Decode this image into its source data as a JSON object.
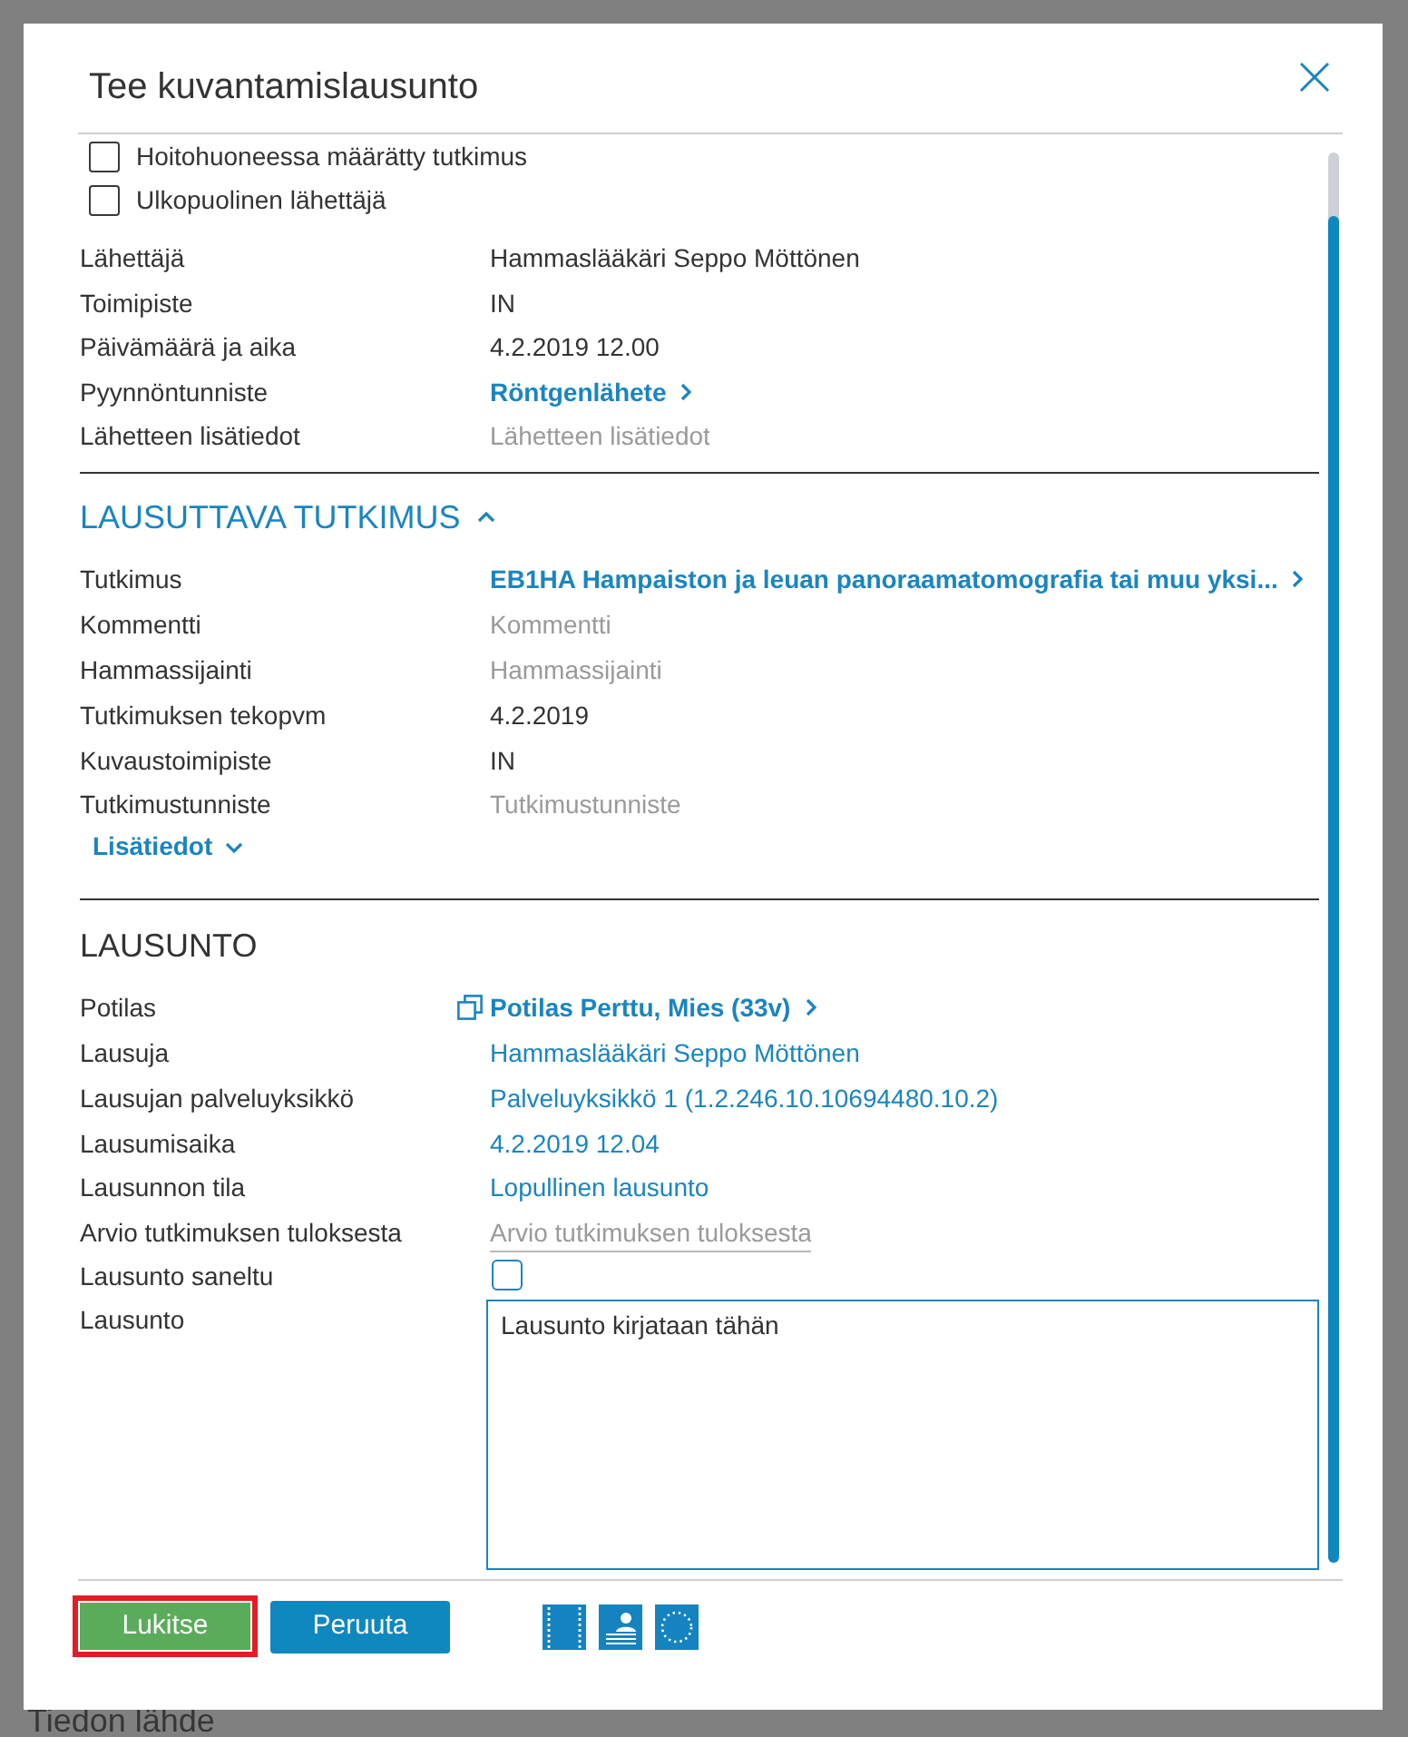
{
  "page": {
    "footer_label": "Tiedon lähde"
  },
  "dialog": {
    "title": "Tee kuvantamislausunto"
  },
  "options": [
    {
      "label": "Hoitohuoneessa määrätty tutkimus",
      "checked": false
    },
    {
      "label": "Ulkopuolinen lähettäjä",
      "checked": false
    }
  ],
  "referral_fields": [
    {
      "label": "Lähettäjä",
      "kind": "text",
      "value": "Hammaslääkäri Seppo Möttönen"
    },
    {
      "label": "Toimipiste",
      "kind": "text",
      "value": "IN"
    },
    {
      "label": "Päivämäärä ja aika",
      "kind": "text",
      "value": "4.2.2019 12.00"
    },
    {
      "label": "Pyynnöntunniste",
      "kind": "link",
      "value": "Röntgenlähete"
    },
    {
      "label": "Lähetteen lisätiedot",
      "kind": "placeholder",
      "placeholder": "Lähetteen lisätiedot"
    }
  ],
  "study_section": {
    "title": "LAUSUTTAVA TUTKIMUS",
    "expanded": true,
    "fields": [
      {
        "label": "Tutkimus",
        "kind": "link",
        "value": "EB1HA Hampaiston ja leuan panoraamatomografia tai muu yksi..."
      },
      {
        "label": "Kommentti",
        "kind": "placeholder",
        "placeholder": "Kommentti"
      },
      {
        "label": "Hammassijainti",
        "kind": "placeholder",
        "placeholder": "Hammassijainti"
      },
      {
        "label": "Tutkimuksen tekopvm",
        "kind": "text",
        "value": "4.2.2019"
      },
      {
        "label": "Kuvaustoimipiste",
        "kind": "text",
        "value": "IN"
      },
      {
        "label": "Tutkimustunniste",
        "kind": "placeholder",
        "placeholder": "Tutkimustunniste"
      }
    ],
    "more": {
      "label": "Lisätiedot",
      "expanded": false
    }
  },
  "statement_section": {
    "title": "LAUSUNTO",
    "fields": [
      {
        "label": "Potilas",
        "kind": "patient",
        "value": "Potilas Perttu, Mies (33v)"
      },
      {
        "label": "Lausuja",
        "kind": "blue",
        "value": "Hammaslääkäri Seppo Möttönen"
      },
      {
        "label": "Lausujan palveluyksikkö",
        "kind": "blue",
        "value": "Palveluyksikkö 1 (1.2.246.10.10694480.10.2)"
      },
      {
        "label": "Lausumisaika",
        "kind": "blue",
        "value": "4.2.2019 12.04"
      },
      {
        "label": "Lausunnon tila",
        "kind": "blue",
        "value": "Lopullinen lausunto"
      },
      {
        "label": "Arvio tutkimuksen tuloksesta",
        "kind": "input",
        "placeholder": "Arvio tutkimuksen tuloksesta"
      },
      {
        "label": "Lausunto saneltu",
        "kind": "checkbox",
        "checked": false
      },
      {
        "label": "Lausunto",
        "kind": "textarea",
        "value": "Lausunto kirjataan tähän"
      }
    ]
  },
  "buttons": [
    {
      "label": "Lukitse",
      "kind": "primary",
      "highlighted": true
    },
    {
      "label": "Peruuta",
      "kind": "secondary",
      "highlighted": false
    }
  ]
}
